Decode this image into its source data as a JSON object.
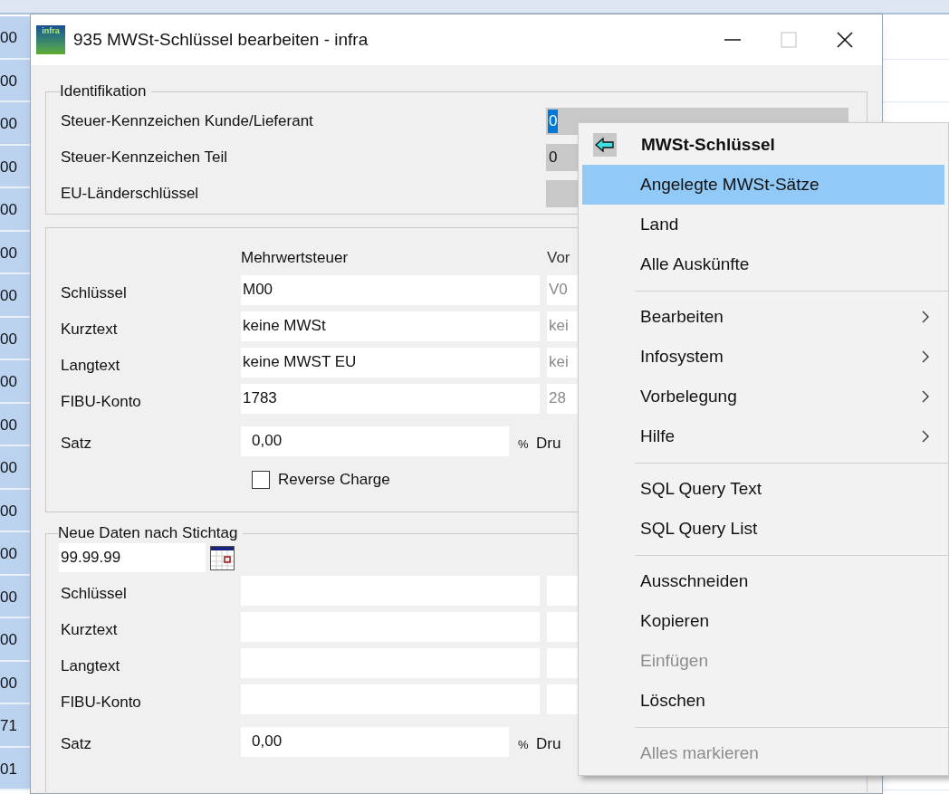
{
  "background_grid": {
    "row_cells": [
      "00",
      "00",
      "00",
      "00",
      "00",
      "00",
      "00",
      "00",
      "00",
      "00",
      "00",
      "00",
      "00",
      "00",
      "00",
      "00",
      "71",
      "01"
    ]
  },
  "window": {
    "title": "935 MWSt-Schlüssel bearbeiten - infra",
    "logo_text": "infra",
    "buttons": [
      {
        "kind": "minimize",
        "disabled": false
      },
      {
        "kind": "maximize",
        "disabled": true
      },
      {
        "kind": "close",
        "disabled": false
      }
    ]
  },
  "identifikation": {
    "title": "Identifikation",
    "fields": [
      {
        "label": "Steuer-Kennzeichen Kunde/Lieferant",
        "value": "0",
        "selected": true
      },
      {
        "label": "Steuer-Kennzeichen Teil",
        "value": "0",
        "selected": false
      },
      {
        "label": "EU-Länderschlüssel",
        "selected": false
      }
    ]
  },
  "tax_group": {
    "columns": [
      {
        "heading": "Mehrwertsteuer",
        "disabled": false
      },
      {
        "heading": "Vor",
        "disabled": true
      }
    ],
    "rows": [
      {
        "label": "Schlüssel",
        "values": [
          "M00",
          "V0"
        ]
      },
      {
        "label": "Kurztext",
        "values": [
          "keine MWSt",
          "kei"
        ]
      },
      {
        "label": "Langtext",
        "values": [
          "keine MWST EU",
          "kei"
        ]
      },
      {
        "label": "FIBU-Konto",
        "values": [
          "1783",
          "28"
        ]
      }
    ],
    "satz": {
      "label": "Satz",
      "value": "0,00",
      "unit": "%",
      "next_label": "Dru"
    },
    "reverse_charge": {
      "label": "Reverse Charge",
      "checked": false
    }
  },
  "new_data": {
    "title": "Neue Daten nach Stichtag",
    "date": "99.99.99",
    "rows": [
      {
        "label": "Schlüssel"
      },
      {
        "label": "Kurztext"
      },
      {
        "label": "Langtext"
      },
      {
        "label": "FIBU-Konto"
      }
    ],
    "satz": {
      "label": "Satz",
      "value": "0,00",
      "unit": "%",
      "next_label": "Dru"
    }
  },
  "context_menu": {
    "items": [
      {
        "kind": "header",
        "label": "MWSt-Schlüssel"
      },
      {
        "kind": "item",
        "label": "Angelegte MWSt-Sätze",
        "selected": true,
        "disabled": false
      },
      {
        "kind": "item",
        "label": "Land",
        "selected": false,
        "disabled": false
      },
      {
        "kind": "item",
        "label": "Alle Auskünfte",
        "selected": false,
        "disabled": false
      },
      {
        "kind": "separator"
      },
      {
        "kind": "submenu",
        "label": "Bearbeiten",
        "selected": false,
        "disabled": false
      },
      {
        "kind": "submenu",
        "label": "Infosystem",
        "selected": false,
        "disabled": false
      },
      {
        "kind": "submenu",
        "label": "Vorbelegung",
        "selected": false,
        "disabled": false
      },
      {
        "kind": "submenu",
        "label": "Hilfe",
        "selected": false,
        "disabled": false
      },
      {
        "kind": "separator"
      },
      {
        "kind": "item",
        "label": "SQL Query Text",
        "selected": false,
        "disabled": false
      },
      {
        "kind": "item",
        "label": "SQL Query List",
        "selected": false,
        "disabled": false
      },
      {
        "kind": "separator"
      },
      {
        "kind": "item",
        "label": "Ausschneiden",
        "selected": false,
        "disabled": false
      },
      {
        "kind": "item",
        "label": "Kopieren",
        "selected": false,
        "disabled": false
      },
      {
        "kind": "item",
        "label": "Einfügen",
        "selected": false,
        "disabled": true
      },
      {
        "kind": "item",
        "label": "Löschen",
        "selected": false,
        "disabled": false
      },
      {
        "kind": "separator"
      },
      {
        "kind": "item",
        "label": "Alles markieren",
        "selected": false,
        "disabled": true
      }
    ]
  }
}
